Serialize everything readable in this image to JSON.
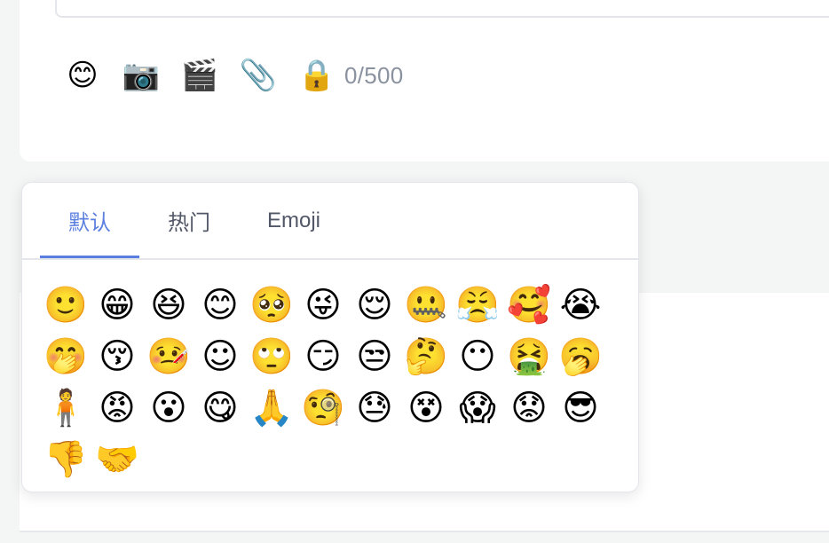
{
  "toolbar": {
    "tools": [
      {
        "name": "emoji-icon",
        "glyph": "😊"
      },
      {
        "name": "camera-icon",
        "glyph": "📷"
      },
      {
        "name": "clapper-icon",
        "glyph": "🎬"
      },
      {
        "name": "paperclip-icon",
        "glyph": "📎"
      },
      {
        "name": "lock-icon",
        "glyph": "🔒"
      }
    ],
    "counter": "0/500"
  },
  "panel": {
    "tabs": [
      {
        "label": "默认",
        "active": true
      },
      {
        "label": "热门",
        "active": false
      },
      {
        "label": "Emoji",
        "active": false
      }
    ],
    "accent_color": "#5b7fde",
    "emojis": [
      "smile-face-icon",
      "grin-face-icon",
      "laugh-face-icon",
      "blush-face-icon",
      "pleading-face-icon",
      "tongue-wink-face-icon",
      "content-face-icon",
      "zipped-face-icon",
      "annoyed-face-icon",
      "love-face-icon",
      "crying-face-icon",
      "snicker-face-icon",
      "kiss-face-icon",
      "sick-face-icon",
      "shy-face-icon",
      "eyeroll-face-icon",
      "smug-face-icon",
      "side-eye-face-icon",
      "thinking-face-icon",
      "black-face-icon",
      "vomit-face-icon",
      "yawn-face-icon",
      "small-man-icon",
      "angry-face-icon",
      "question-face-icon",
      "drool-face-icon",
      "pray-face-icon",
      "hmm-face-icon",
      "sweat-face-icon",
      "slap-face-icon",
      "scream-face-icon",
      "sad-face-icon",
      "sunglasses-face-icon",
      "thumbs-down-icon",
      "handshake-icon"
    ]
  }
}
